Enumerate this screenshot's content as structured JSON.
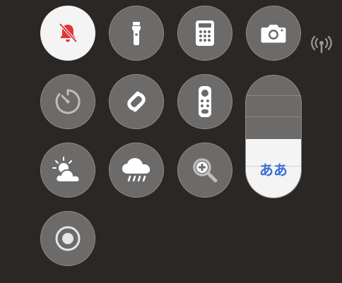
{
  "controls": [
    {
      "name": "silent-mode",
      "icon": "bell-slash-icon",
      "active": true,
      "accent": "#e0353b"
    },
    {
      "name": "flashlight",
      "icon": "flashlight-icon",
      "active": false
    },
    {
      "name": "calculator",
      "icon": "calculator-icon",
      "active": false
    },
    {
      "name": "camera",
      "icon": "camera-icon",
      "active": false
    },
    {
      "name": "timer",
      "icon": "timer-icon",
      "active": false
    },
    {
      "name": "shazam",
      "icon": "shazam-icon",
      "active": false
    },
    {
      "name": "apple-tv-remote",
      "icon": "remote-icon",
      "active": false
    },
    {
      "name": "weather-partly-cloudy",
      "icon": "partly-cloudy-icon",
      "active": false
    },
    {
      "name": "weather-rain",
      "icon": "cloud-rain-icon",
      "active": false
    },
    {
      "name": "magnifier",
      "icon": "magnifier-plus-icon",
      "active": false
    },
    {
      "name": "screen-recording",
      "icon": "record-icon",
      "active": false
    }
  ],
  "text_size_slider": {
    "label": "ああ",
    "level_fraction": 0.48,
    "label_color": "#3b6fd6"
  },
  "status_icon": "antenna-signal-icon",
  "colors": {
    "background": "#2a2725",
    "button": "#6d6b6a",
    "active_button": "#f4f4f4"
  }
}
